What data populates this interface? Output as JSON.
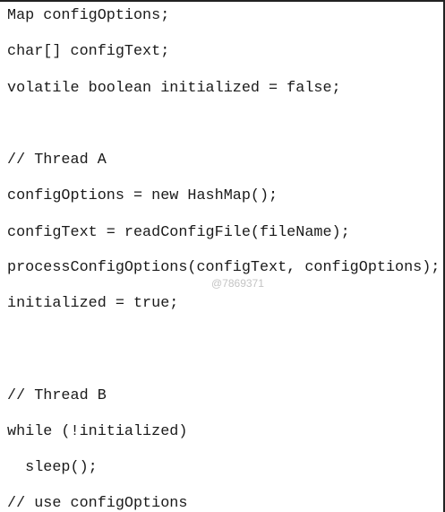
{
  "code_lines": [
    "Map configOptions;",
    "char[] configText;",
    "volatile boolean initialized = false;",
    "// Thread A",
    "configOptions = new HashMap();",
    "configText = readConfigFile(fileName);",
    "processConfigOptions(configText, configOptions);",
    "initialized = true;",
    "// Thread B",
    "while (!initialized)",
    "  sleep();",
    "// use configOptions"
  ],
  "watermark": "@7869371"
}
